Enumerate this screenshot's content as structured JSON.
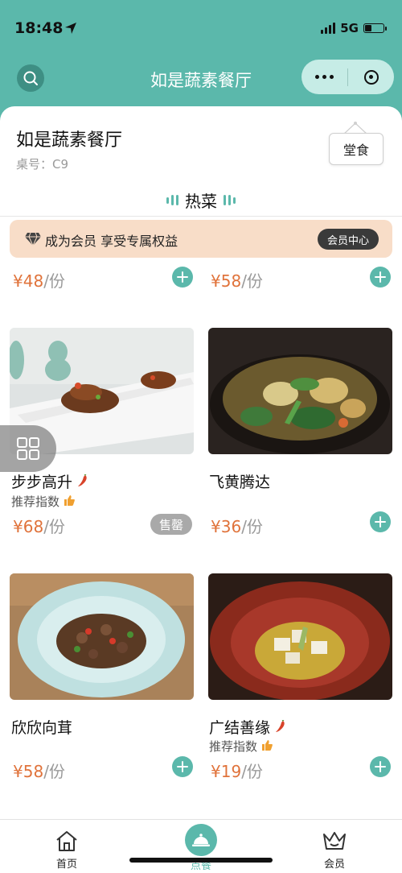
{
  "status_bar": {
    "time": "18:48",
    "network": "5G"
  },
  "header": {
    "title": "如是蔬素餐厅"
  },
  "restaurant": {
    "name": "如是蔬素餐厅",
    "table_number": "桌号：C9",
    "dine_mode": "堂食"
  },
  "section": {
    "title": "热菜"
  },
  "member_banner": {
    "text": "成为会员 享受专属权益",
    "button": "会员中心"
  },
  "dishes_partial": [
    {
      "price": "¥48",
      "unit": "/份"
    },
    {
      "price": "¥58",
      "unit": "/份"
    }
  ],
  "dishes": [
    {
      "name": "步步高升",
      "spicy": true,
      "recommend": "推荐指数",
      "price": "¥68",
      "unit": "/份",
      "sold_out": "售罄"
    },
    {
      "name": "飞黄腾达",
      "spicy": false,
      "price": "¥36",
      "unit": "/份"
    },
    {
      "name": "欣欣向茸",
      "spicy": false,
      "price": "¥58",
      "unit": "/份"
    },
    {
      "name": "广结善缘",
      "spicy": true,
      "recommend": "推荐指数",
      "price": "¥19",
      "unit": "/份"
    }
  ],
  "bottom_nav": [
    {
      "label": "首页",
      "icon": "home-icon"
    },
    {
      "label": "点餐",
      "icon": "cloche-icon"
    },
    {
      "label": "会员",
      "icon": "crown-icon"
    }
  ],
  "colors": {
    "primary": "#5bb8ab",
    "price": "#e0733b",
    "banner": "#f8ddc8"
  }
}
